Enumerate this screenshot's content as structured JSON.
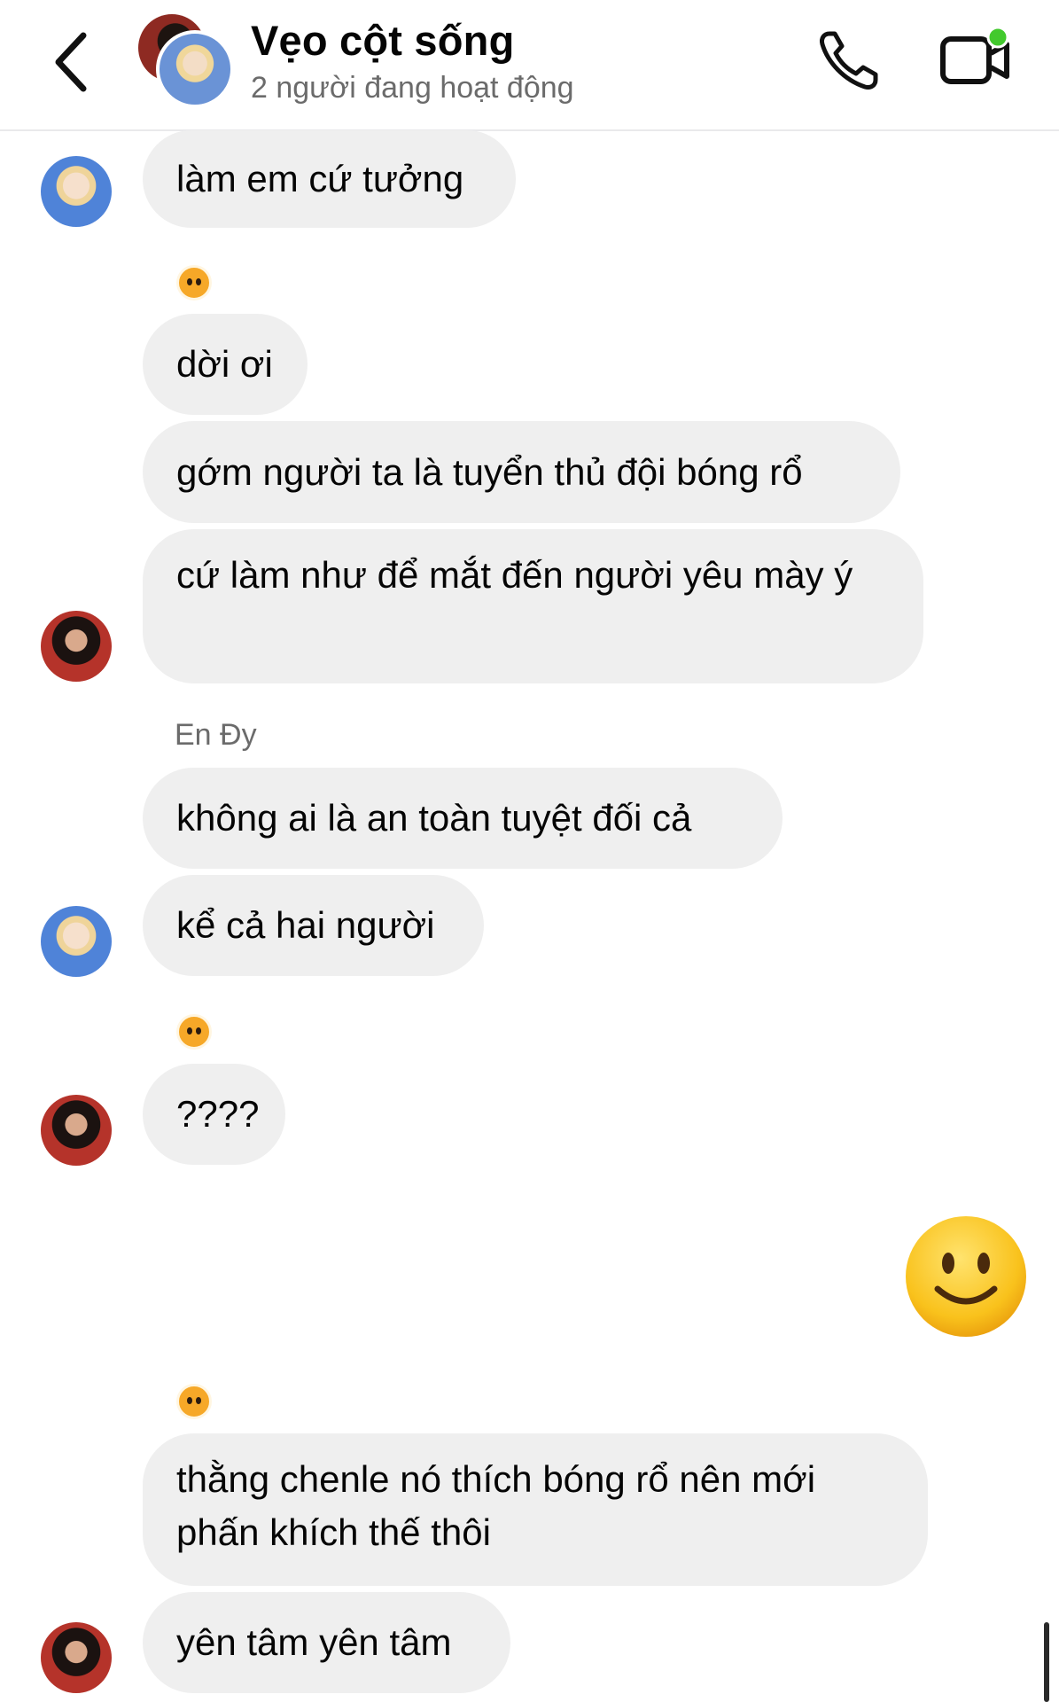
{
  "header": {
    "title": "Vẹo cột sống",
    "status": "2 người đang hoạt động",
    "icons": {
      "back": "chevron-left-icon",
      "call": "phone-icon",
      "video": "video-camera-icon"
    },
    "colors": {
      "active_dot": "#42c92d"
    }
  },
  "messages": [
    {
      "sender": "blue",
      "text": "làm em cứ tưởng"
    },
    {
      "reaction": "tiger-face-emoji"
    },
    {
      "sender": "red",
      "text": "dời ơi"
    },
    {
      "sender": "red",
      "text": "gớm người ta là tuyển thủ đội bóng rổ"
    },
    {
      "sender": "red",
      "text": "cứ làm như để mắt đến người yêu mày ý"
    },
    {
      "sender_name": "En Đy"
    },
    {
      "sender": "blue",
      "text": "không ai là an toàn tuyệt đối cả"
    },
    {
      "sender": "blue",
      "text": "kể cả hai người"
    },
    {
      "reaction": "tiger-face-emoji"
    },
    {
      "sender": "red",
      "text": "????"
    },
    {
      "sender": "me",
      "emoji": "slightly-smiling-face-emoji"
    },
    {
      "reaction": "tiger-face-emoji"
    },
    {
      "sender": "red",
      "text": "thằng chenle nó thích bóng rổ nên mới phấn khích thế thôi"
    },
    {
      "sender": "red",
      "text": "yên tâm yên tâm"
    }
  ],
  "colors": {
    "bubble_bg": "#efefef",
    "text": "#050505",
    "secondary_text": "#6b6b6b"
  }
}
